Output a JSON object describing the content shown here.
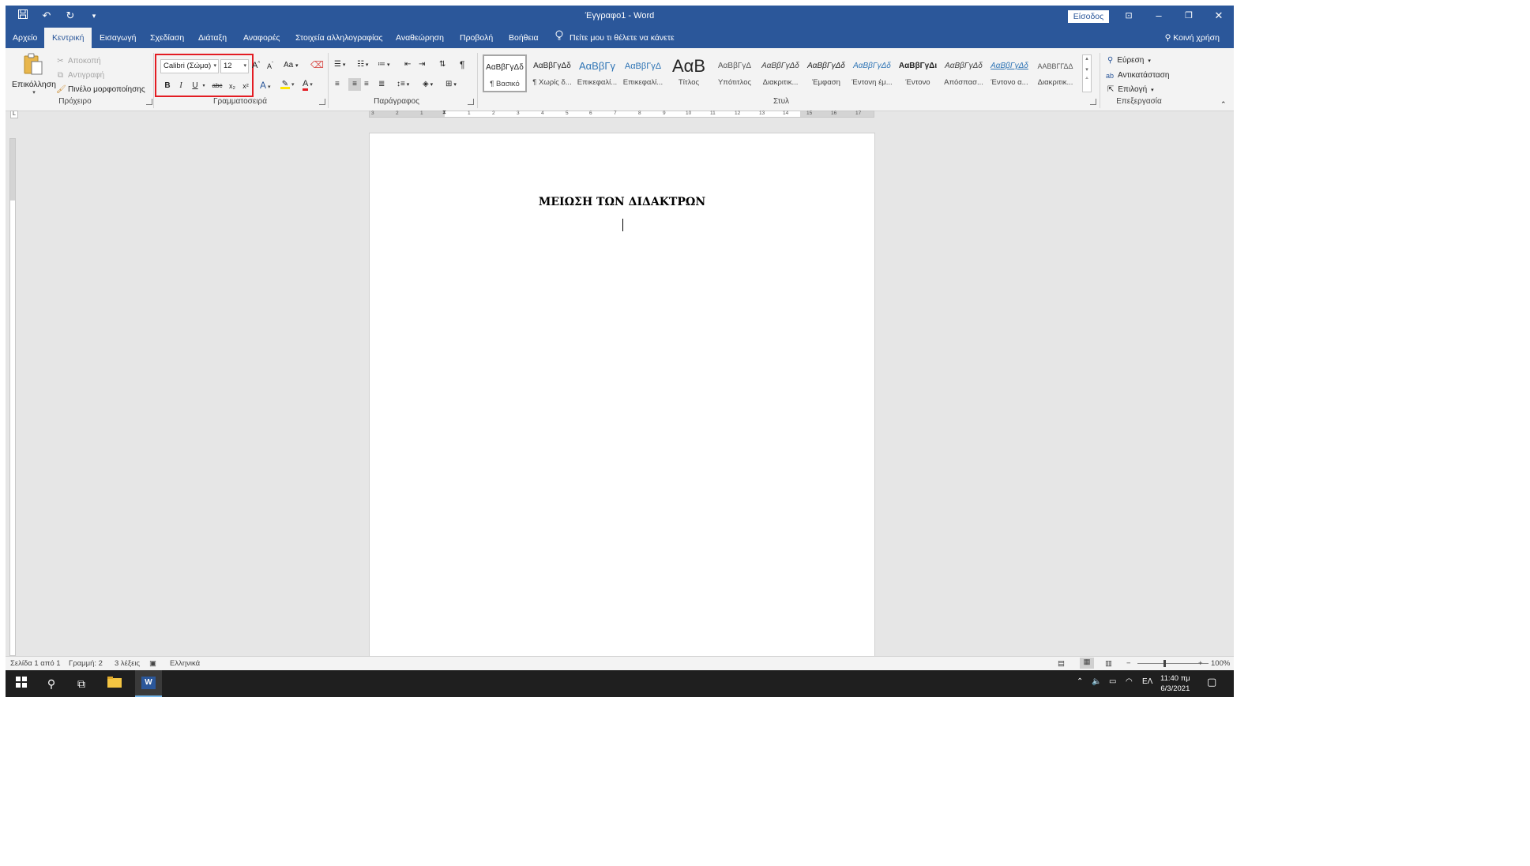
{
  "titlebar": {
    "title": "Έγγραφο1  -  Word",
    "signin_label": "Είσοδος"
  },
  "tabs": [
    "Αρχείο",
    "Κεντρική",
    "Εισαγωγή",
    "Σχεδίαση",
    "Διάταξη",
    "Αναφορές",
    "Στοιχεία αλληλογραφίας",
    "Αναθεώρηση",
    "Προβολή",
    "Βοήθεια"
  ],
  "tellme_text": "Πείτε μου τι θέλετε να κάνετε",
  "share_label": "Κοινή χρήση",
  "clipboard": {
    "paste_label": "Επικόλληση",
    "cut_label": "Αποκοπή",
    "copy_label": "Αντιγραφή",
    "format_painter_label": "Πινέλο μορφοποίησης",
    "group_label": "Πρόχειρο"
  },
  "font": {
    "font_name": "Calibri (Σώμα)",
    "font_size": "12",
    "group_label": "Γραμματοσειρά",
    "bold": "B",
    "italic": "I",
    "underline": "U",
    "strike": "abc",
    "subscript": "x₂",
    "superscript": "x²",
    "change_case": "Aa",
    "grow": "A",
    "shrink": "A",
    "text_effects": "A",
    "font_color": "A"
  },
  "paragraph": {
    "group_label": "Παράγραφος"
  },
  "styles": {
    "group_label": "Στυλ",
    "items": [
      {
        "preview": "ΑαΒβΓγΔδ",
        "name": "¶ Βασικό"
      },
      {
        "preview": "ΑαΒβΓγΔδ",
        "name": "¶ Χωρίς δ..."
      },
      {
        "preview": "ΑαΒβΓγ",
        "name": "Επικεφαλί..."
      },
      {
        "preview": "ΑαΒβΓγΔ",
        "name": "Επικεφαλί..."
      },
      {
        "preview": "ΑαΒ",
        "name": "Τίτλος"
      },
      {
        "preview": "ΑαΒβΓγΔ",
        "name": "Υπότιτλος"
      },
      {
        "preview": "ΑαΒβΓγΔδ",
        "name": "Διακριτικ..."
      },
      {
        "preview": "ΑαΒβΓγΔδ",
        "name": "Έμφαση"
      },
      {
        "preview": "ΑαΒβΓγΔδ",
        "name": "Έντονη έμ..."
      },
      {
        "preview": "ΑαΒβΓγΔι",
        "name": "Έντονο"
      },
      {
        "preview": "ΑαΒβΓγΔδ",
        "name": "Απόσπασ..."
      },
      {
        "preview": "ΑαΒβΓγΔδ",
        "name": "Έντονο α..."
      },
      {
        "preview": "ΑΑΒΒΓΓΔΔ",
        "name": "Διακριτικ..."
      }
    ]
  },
  "editing": {
    "group_label": "Επεξεργασία",
    "find_label": "Εύρεση",
    "replace_label": "Αντικατάσταση",
    "select_label": "Επιλογή"
  },
  "ruler_numbers": [
    "3",
    "2",
    "1",
    "1",
    "2",
    "3",
    "4",
    "5",
    "6",
    "7",
    "8",
    "9",
    "10",
    "11",
    "12",
    "13",
    "14",
    "15",
    "16",
    "17"
  ],
  "document": {
    "title": "ΜΕΙΩΣΗ ΤΩΝ ΔΙΔΑΚΤΡΩΝ"
  },
  "status": {
    "page": "Σελίδα 1 από 1",
    "line": "Γραμμή: 2",
    "words": "3 λέξεις",
    "language": "Ελληνικά",
    "zoom": "100%"
  },
  "taskbar": {
    "lang": "ΕΛ",
    "time": "11:40 πμ",
    "date": "6/3/2021"
  },
  "colors": {
    "word_blue": "#2b579a",
    "highlight_red": "#e31c23"
  }
}
